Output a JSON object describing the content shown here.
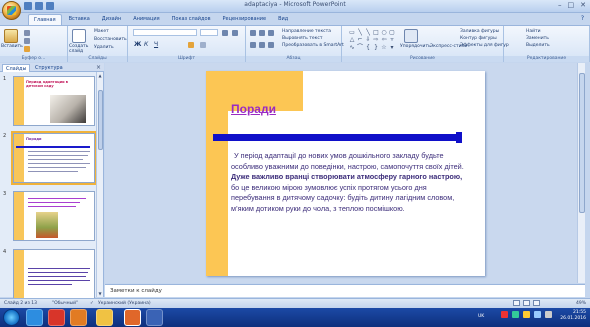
{
  "window": {
    "title": "adaptaciya - Microsoft PowerPoint",
    "min": "–",
    "max": "□",
    "close": "✕"
  },
  "ribbon": {
    "tabs": [
      "Главная",
      "Вставка",
      "Дизайн",
      "Анимация",
      "Показ слайдов",
      "Рецензирование",
      "Вид"
    ],
    "help": "?",
    "groups": {
      "clipboard": "Буфер о...",
      "slides": "Слайды",
      "font": "Шрифт",
      "paragraph": "Абзац",
      "drawing": "Рисование",
      "editing": "Редактирование"
    },
    "labels": {
      "paste": "Вставить",
      "create_slide": "Создать слайд",
      "layout": "Макет",
      "reset": "Восстановить",
      "delete": "Удалить",
      "text_direction": "Направление текста",
      "align_text": "Выровнять текст",
      "smartart": "Преобразовать в SmartArt",
      "arrange": "Упорядочить",
      "quick_styles": "Экспресс-стили",
      "shape_fill": "Заливка фигуры",
      "shape_outline": "Контур фигуры",
      "shape_effects": "Эффекты для фигур",
      "find": "Найти",
      "replace": "Заменить",
      "select": "Выделить"
    }
  },
  "left_pane": {
    "tab_slides": "Слайды",
    "tab_outline": "Структура",
    "close": "×",
    "thumbs": [
      {
        "num": "1",
        "title": "Период адаптации в детском саду"
      },
      {
        "num": "2",
        "title": "Поради"
      },
      {
        "num": "3",
        "title": ""
      },
      {
        "num": "4",
        "title": ""
      }
    ]
  },
  "slide": {
    "title": "Поради",
    "para1": "У період адаптації до нових умов дошкільного закладу будьте особливо уважними до поведінки, настрою, самопочуття своїх дітей.",
    "para2_bold": "Дуже важливо вранці створювати атмосферу гарного настрою,",
    "para2_rest": " бо це великою мірою зумовлює успіх протягом усього дня перебування в дитячому садочку: будіть дитину лагідним словом, м’яким дотиком руки до чола, з теплою посмішкою."
  },
  "notes": {
    "placeholder": "Заметки к слайду"
  },
  "status": {
    "slide_counter": "Слайд 2 из 13",
    "theme": "\"Обычный\"",
    "language": "Украинский (Украина)",
    "zoom": "49%"
  },
  "taskbar": {
    "lang": "UK",
    "time": "21:55",
    "date": "26.01.2016"
  },
  "colors": {
    "title": "#9a2bc3",
    "accent_gold": "#fcc654",
    "accent_blue": "#1010c9",
    "body_text": "#3c2d7a"
  }
}
